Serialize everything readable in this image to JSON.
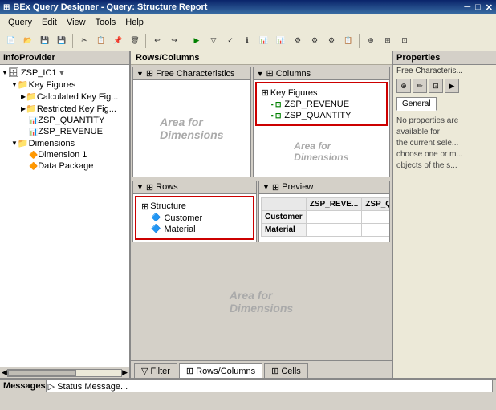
{
  "window": {
    "title": "BEx Query Designer - Query: Structure Report",
    "icon": "⊞"
  },
  "menu": {
    "items": [
      "Query",
      "Edit",
      "View",
      "Tools",
      "Help"
    ]
  },
  "panels": {
    "infoProvider": {
      "header": "InfoProvider",
      "root": "ZSP_IC1",
      "tree": {
        "keyFigures": {
          "label": "Key Figures",
          "children": [
            {
              "label": "Calculated Key Fig...",
              "type": "calc"
            },
            {
              "label": "Restricted Key Fig...",
              "type": "restricted"
            },
            {
              "label": "ZSP_QUANTITY",
              "type": "keyfig"
            },
            {
              "label": "ZSP_REVENUE",
              "type": "keyfig"
            }
          ]
        },
        "dimensions": {
          "label": "Dimensions",
          "children": [
            {
              "label": "Dimension 1",
              "type": "dim"
            },
            {
              "label": "Data Package",
              "type": "dim"
            }
          ]
        }
      }
    },
    "rowsColumns": {
      "header": "Rows/Columns",
      "freeChars": {
        "label": "Free Characteristics",
        "placeholder": "Area for\nDimensions"
      },
      "columns": {
        "label": "Columns",
        "items": [
          {
            "label": "Key Figures",
            "type": "struct"
          },
          {
            "label": "ZSP_REVENUE",
            "type": "keyfig"
          },
          {
            "label": "ZSP_QUANTITY",
            "type": "keyfig"
          }
        ],
        "placeholder": "Area for\nDimensions"
      },
      "rows": {
        "label": "Rows",
        "items": [
          {
            "label": "Structure",
            "type": "struct"
          },
          {
            "label": "Customer",
            "type": "dim"
          },
          {
            "label": "Material",
            "type": "dim"
          }
        ]
      },
      "preview": {
        "label": "Preview",
        "colHeaders": [
          "ZSP_REVE...",
          "ZSP_QUAN..."
        ],
        "rows": [
          {
            "header": "Customer",
            "values": [
              "",
              ""
            ]
          },
          {
            "header": "Material",
            "values": [
              "",
              ""
            ]
          }
        ]
      }
    },
    "properties": {
      "header": "Properties",
      "subheader": "Free Characteris...",
      "tabs": [
        "General"
      ],
      "content": "No properties are\navailable for\nthe current sele\nchoose one or m\nobjects of the s..."
    }
  },
  "bottomTabs": [
    {
      "label": "Filter",
      "icon": "▽",
      "active": false
    },
    {
      "label": "Rows/Columns",
      "icon": "⊞",
      "active": true
    },
    {
      "label": "Cells",
      "icon": "⊞",
      "active": false
    }
  ],
  "messages": {
    "header": "Messages",
    "status": "▷ Status Message..."
  }
}
